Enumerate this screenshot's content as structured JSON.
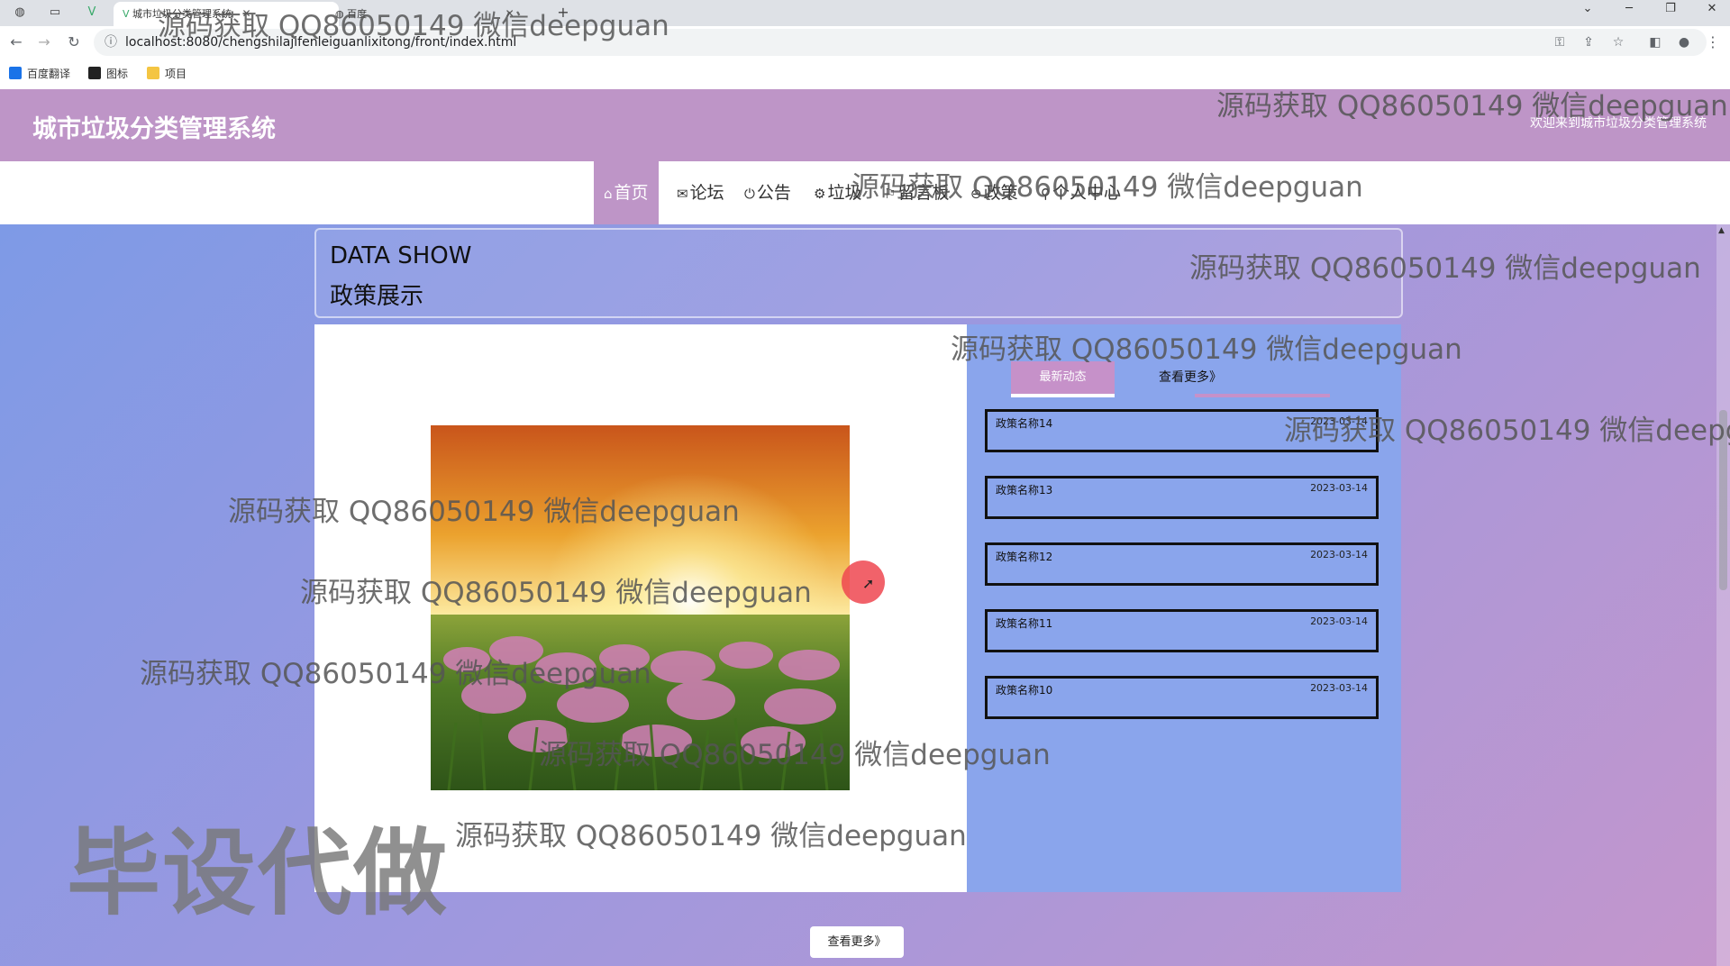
{
  "browser": {
    "tabs": [
      {
        "label": "城市垃圾分类管理系统",
        "active": true
      },
      {
        "label": "百度",
        "active": false
      }
    ],
    "new_tab_icon": "plus-icon",
    "url": "localhost:8080/chengshilajifenleiguanlixitong/front/index.html",
    "bookmarks": [
      {
        "label": "百度翻译",
        "color": "#1a73e8"
      },
      {
        "label": "图标",
        "color": "#222222"
      },
      {
        "label": "项目",
        "color": "#f4c542"
      }
    ]
  },
  "site": {
    "title": "城市垃圾分类管理系统",
    "welcome": "欢迎来到城市垃圾分类管理系统",
    "accent": "#be95c7",
    "nav": [
      {
        "label": "首页",
        "icon": "home-icon",
        "glyph": "⌂",
        "active": true
      },
      {
        "label": "论坛",
        "icon": "mail-icon",
        "glyph": "✉",
        "active": false
      },
      {
        "label": "公告",
        "icon": "power-icon",
        "glyph": "⏻",
        "active": false
      },
      {
        "label": "垃圾",
        "icon": "gear-icon",
        "glyph": "⚙",
        "active": false
      },
      {
        "label": "留言板",
        "icon": "flag-icon",
        "glyph": "⚐",
        "active": false
      },
      {
        "label": "政策",
        "icon": "chat-icon",
        "glyph": "⊖",
        "active": false
      },
      {
        "label": "个人中心",
        "icon": "user-icon",
        "glyph": "⚲",
        "active": false
      }
    ]
  },
  "section": {
    "title_en": "DATA SHOW",
    "title_cn": "政策展示"
  },
  "policy": {
    "latest_tab": "最新动态",
    "more_link": "查看更多》",
    "items": [
      {
        "name": "政策名称14",
        "date": "2023-03-14"
      },
      {
        "name": "政策名称13",
        "date": "2023-03-14"
      },
      {
        "name": "政策名称12",
        "date": "2023-03-14"
      },
      {
        "name": "政策名称11",
        "date": "2023-03-14"
      },
      {
        "name": "政策名称10",
        "date": "2023-03-14"
      }
    ],
    "bottom_more": "查看更多》"
  },
  "overlay": {
    "watermark": "源码获取 QQ86050149 微信deepguan",
    "stamp": "毕设代做"
  }
}
